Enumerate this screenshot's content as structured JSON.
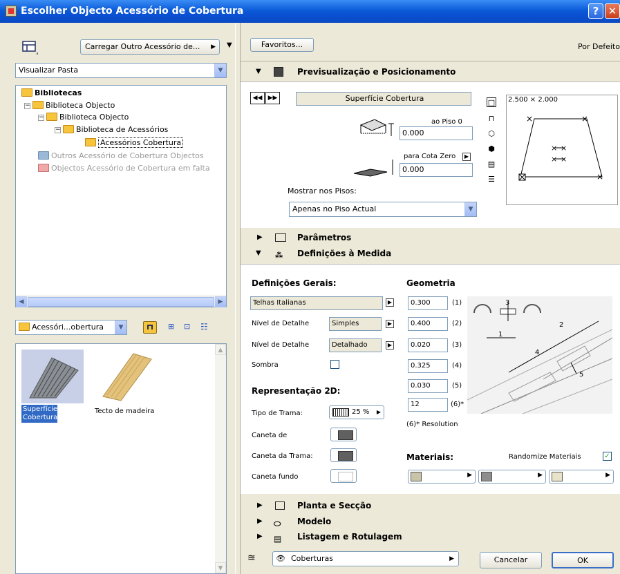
{
  "window": {
    "title": "Escolher Objecto Acessório de Cobertura"
  },
  "left": {
    "load_button": "Carregar Outro Acessório de...",
    "view_select": "Visualizar Pasta",
    "tree": [
      {
        "label": "Bibliotecas"
      },
      {
        "label": "Biblioteca Objecto"
      },
      {
        "label": "Biblioteca Objecto"
      },
      {
        "label": "Biblioteca de Acessórios"
      },
      {
        "label": "Acessórios Cobertura"
      },
      {
        "label": "Outros Acessório de Cobertura Objectos"
      },
      {
        "label": "Objectos Acessório de Cobertura em falta"
      }
    ],
    "folder_select": "Acessóri...obertura",
    "items": [
      {
        "label": "Superfície Cobertura",
        "selected": true
      },
      {
        "label": "Tecto de madeira",
        "selected": false
      }
    ]
  },
  "right": {
    "favorites_button": "Favoritos...",
    "default_label": "Por Defeito",
    "preview_section": {
      "title": "Previsualização e Posicionamento",
      "name_field": "Superfície Cobertura",
      "piso_label": "ao Piso 0",
      "piso_value": "0.000",
      "cota_label": "para Cota Zero",
      "cota_value": "0.000",
      "show_floors_label": "Mostrar nos Pisos:",
      "show_floors_value": "Apenas no Piso Actual",
      "preview_size": "2.500 × 2.000"
    },
    "params_section": {
      "title": "Parâmetros"
    },
    "custom_section": {
      "title": "Definições à Medida",
      "general_title": "Definições Gerais:",
      "geometry_title": "Geometria",
      "tile_type": "Telhas Italianas",
      "detail_label_1": "Nível de Detalhe",
      "detail_value_1": "Simples",
      "detail_label_2": "Nível de Detalhe",
      "detail_value_2": "Detalhado",
      "shadow_label": "Sombra",
      "geometry": [
        {
          "value": "0.300",
          "tag": "(1)"
        },
        {
          "value": "0.400",
          "tag": "(2)"
        },
        {
          "value": "0.020",
          "tag": "(3)"
        },
        {
          "value": "0.325",
          "tag": "(4)"
        },
        {
          "value": "0.030",
          "tag": "(5)"
        },
        {
          "value": "12",
          "tag": "(6)*"
        }
      ],
      "resolution_note": "(6)* Resolution",
      "rep2d_title": "Representação 2D:",
      "fill_type_label": "Tipo de Trama:",
      "fill_type_value": "25 %",
      "pen_label": "Caneta de",
      "fill_pen_label": "Caneta da Trama:",
      "bg_pen_label": "Caneta fundo",
      "materials_title": "Materiais:",
      "randomize_label": "Randomize Materiais",
      "diagram_labels": [
        "1",
        "2",
        "3",
        "4",
        "5"
      ]
    },
    "collapsed_sections": [
      "Planta e Secção",
      "Modelo",
      "Listagem e Rotulagem"
    ],
    "layer_select": "Coberturas",
    "cancel_button": "Cancelar",
    "ok_button": "OK"
  }
}
